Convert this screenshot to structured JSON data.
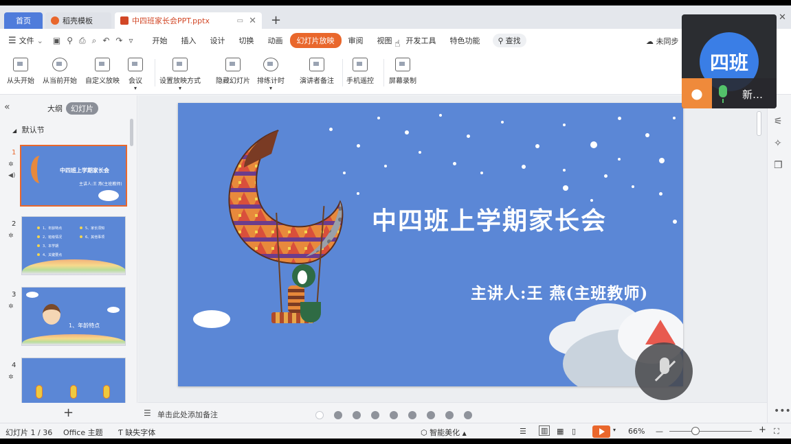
{
  "tabs": {
    "home": "首页",
    "template": "稻壳模板",
    "file": "中四班家长会PPT.pptx"
  },
  "menu": {
    "file": "文件",
    "items": [
      "开始",
      "插入",
      "设计",
      "切换",
      "动画",
      "幻灯片放映",
      "审阅",
      "视图",
      "开发工具",
      "特色功能"
    ],
    "active_index": 5,
    "search": "查找",
    "sync": "未同步"
  },
  "ribbon": {
    "buttons": [
      "从头开始",
      "从当前开始",
      "自定义放映",
      "会议",
      "设置放映方式",
      "隐藏幻灯片",
      "排练计时",
      "演讲者备注",
      "手机遥控",
      "屏幕录制"
    ]
  },
  "left_pane": {
    "tab_outline": "大纲",
    "tab_slides": "幻灯片",
    "section": "默认节",
    "thumbnails": [
      {
        "num": "1",
        "title": "中四班上学期家长会",
        "sub": "主讲人:王 燕(主班教师)"
      },
      {
        "num": "2",
        "items": [
          "1、年龄特点",
          "2、班级情况",
          "3、本学期",
          "4、关键要点",
          "5、家长须知",
          "6、其他事项"
        ]
      },
      {
        "num": "3",
        "title": "1、年龄特点"
      },
      {
        "num": "4"
      }
    ]
  },
  "slide": {
    "title": "中四班上学期家长会",
    "subtitle": "主讲人:王 燕(主班教师)"
  },
  "notes": {
    "placeholder": "单击此处添加备注",
    "dot_count": 9,
    "current_dot": 0
  },
  "status": {
    "slide_counter": "幻灯片 1 / 36",
    "theme": "Office 主题",
    "missing_font": "缺失字体",
    "beautify": "智能美化",
    "zoom": "66%"
  },
  "call": {
    "avatar_text": "四班",
    "name": "新…"
  },
  "colors": {
    "slide_bg": "#5b87d6",
    "accent": "#e9672c",
    "home_tab": "#4f7cdb"
  }
}
